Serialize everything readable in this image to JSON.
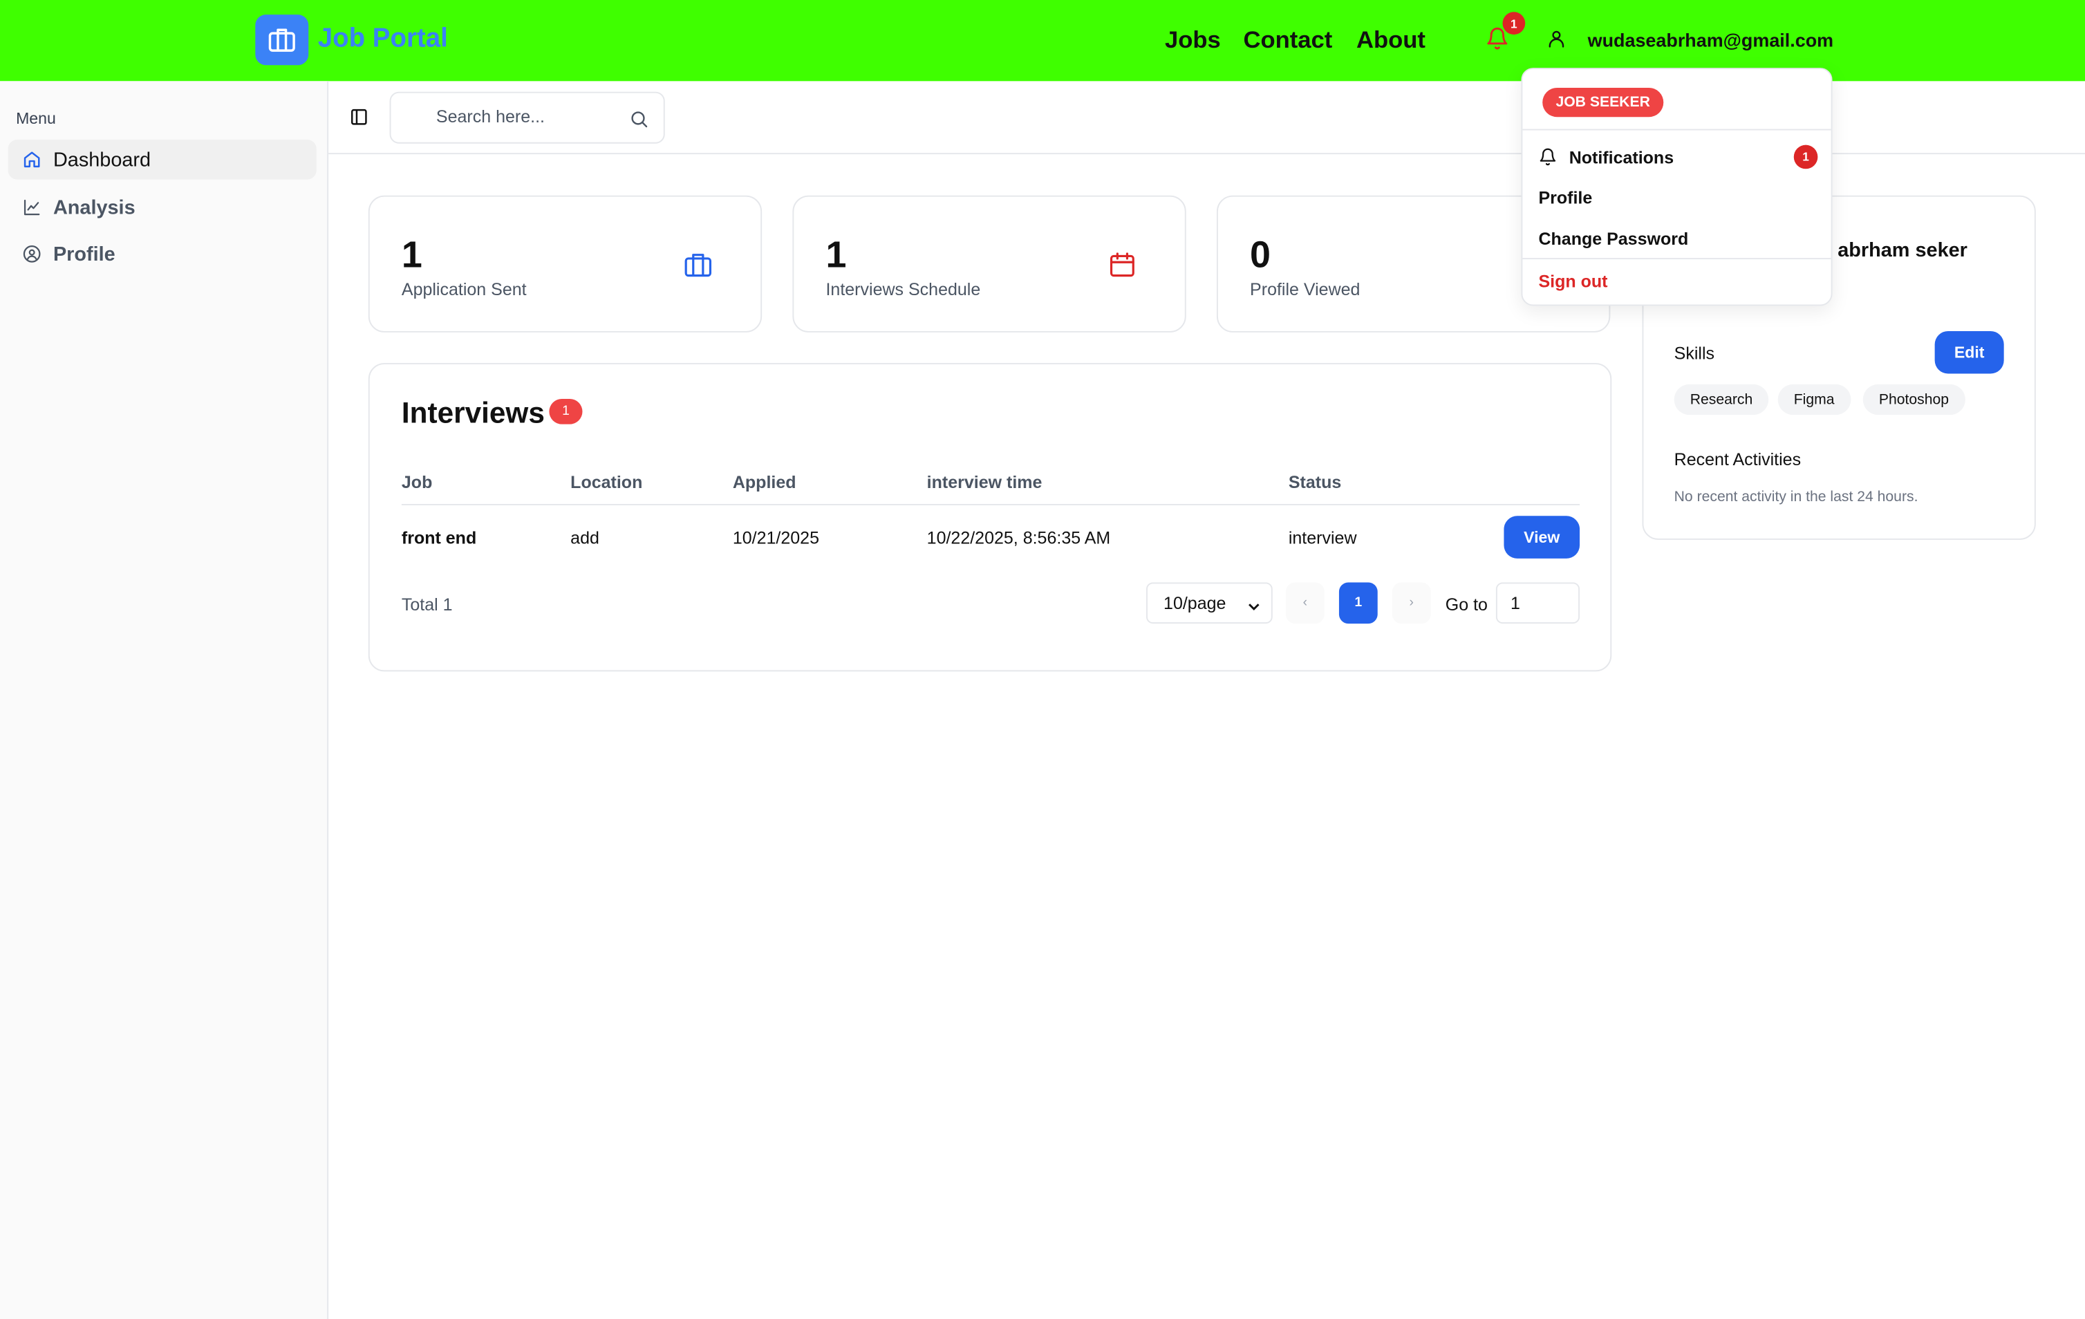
{
  "app": {
    "logo_text": "Job Portal",
    "nav": [
      "Jobs",
      "Contact",
      "About"
    ],
    "notification_count": "1",
    "user_email": "wudaseabrham@gmail.com"
  },
  "sidebar": {
    "menu_label": "Menu",
    "items": [
      {
        "label": "Dashboard",
        "icon": "home-icon"
      },
      {
        "label": "Analysis",
        "icon": "chart-line-icon"
      },
      {
        "label": "Profile",
        "icon": "user-circle-icon"
      }
    ]
  },
  "search": {
    "placeholder": "Search here..."
  },
  "stats": [
    {
      "value": "1",
      "label": "Application Sent",
      "icon": "briefcase-icon",
      "color": "#2563eb"
    },
    {
      "value": "1",
      "label": "Interviews Schedule",
      "icon": "calendar-icon",
      "color": "#dc2626"
    },
    {
      "value": "0",
      "label": "Profile Viewed"
    }
  ],
  "interviews": {
    "title": "Interviews",
    "badge": "1",
    "columns": [
      "Job",
      "Location",
      "Applied",
      "interview time",
      "Status"
    ],
    "rows": [
      {
        "job": "front end",
        "location": "add",
        "applied": "10/21/2025",
        "time": "10/22/2025, 8:56:35 AM",
        "status": "interview",
        "action": "View"
      }
    ],
    "total": "Total 1",
    "page_size": "10/page",
    "prev": "‹",
    "current_page": "1",
    "next": "›",
    "goto_label": "Go to",
    "goto_value": "1"
  },
  "profile_panel": {
    "name": "abrham seker",
    "skills_label": "Skills",
    "edit_label": "Edit",
    "skills": [
      "Research",
      "Figma",
      "Photoshop"
    ],
    "recent_label": "Recent Activities",
    "recent_text": "No recent activity in the last 24 hours."
  },
  "dropdown": {
    "role": "JOB SEEKER",
    "notifications_label": "Notifications",
    "notifications_count": "1",
    "profile_label": "Profile",
    "change_password_label": "Change Password",
    "sign_out_label": "Sign out"
  },
  "colors": {
    "topbar": "#3fff00",
    "primary": "#2563eb",
    "danger": "#ef4444"
  }
}
